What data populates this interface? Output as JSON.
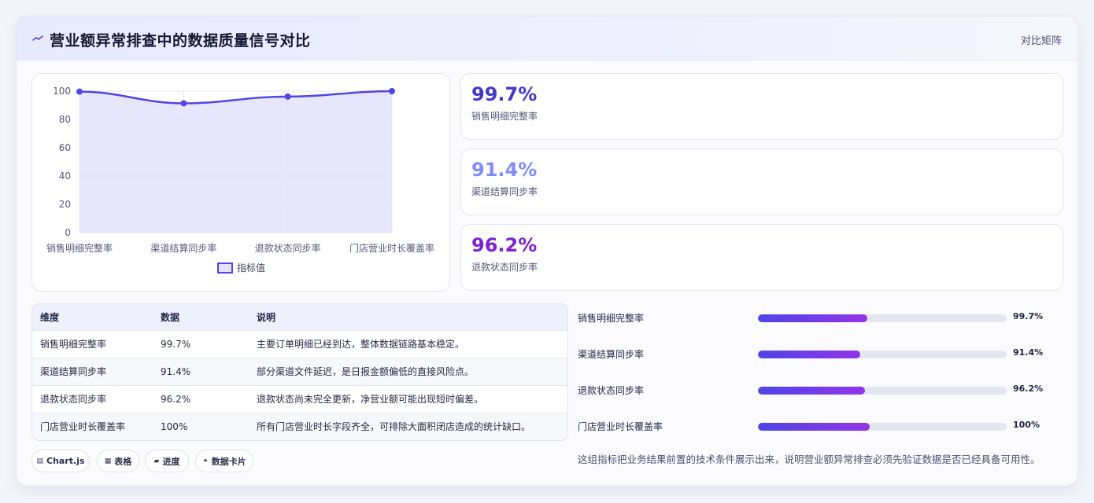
{
  "header": {
    "title": "营业额异常排查中的数据质量信号对比",
    "right_link": "对比矩阵"
  },
  "chart_data": {
    "type": "area",
    "categories": [
      "销售明细完整率",
      "渠道结算同步率",
      "退款状态同步率",
      "门店营业时长覆盖率"
    ],
    "series": [
      {
        "name": "指标值",
        "values": [
          99.7,
          91.4,
          96.2,
          100
        ]
      }
    ],
    "title": "",
    "xlabel": "",
    "ylabel": "",
    "ylim": [
      0,
      100
    ],
    "yticks": [
      "0",
      "20",
      "40",
      "60",
      "80",
      "100"
    ],
    "grid": true,
    "legend": "bottom",
    "colors": {
      "line": "#4f46e5",
      "fill": "#e4e2f9"
    }
  },
  "kpis": [
    {
      "value": "99.7%",
      "label": "销售明细完整率",
      "color": "#4338ca"
    },
    {
      "value": "91.4%",
      "label": "渠道结算同步率",
      "color": "#818cf8"
    },
    {
      "value": "96.2%",
      "label": "退款状态同步率",
      "color": "#7e22ce"
    }
  ],
  "table": {
    "headers": [
      "维度",
      "数据",
      "说明"
    ],
    "rows": [
      [
        "销售明细完整率",
        "99.7%",
        "主要订单明细已经到达，整体数据链路基本稳定。"
      ],
      [
        "渠道结算同步率",
        "91.4%",
        "部分渠道文件延迟，是日报金额偏低的直接风险点。"
      ],
      [
        "退款状态同步率",
        "96.2%",
        "退款状态尚未完全更新，净营业额可能出现短时偏差。"
      ],
      [
        "门店营业时长覆盖率",
        "100%",
        "所有门店营业时长字段齐全，可排除大面积闭店造成的统计缺口。"
      ]
    ]
  },
  "chips": [
    {
      "icon": "▤",
      "label": "Chart.js"
    },
    {
      "icon": "▦",
      "label": "表格"
    },
    {
      "icon": "▰",
      "label": "进度"
    },
    {
      "icon": "✦",
      "label": "数据卡片"
    }
  ],
  "progress": [
    {
      "label": "销售明细完整率",
      "value_text": "99.7%",
      "fill_fraction": 0.44
    },
    {
      "label": "渠道结算同步率",
      "value_text": "91.4%",
      "fill_fraction": 0.41
    },
    {
      "label": "退款状态同步率",
      "value_text": "96.2%",
      "fill_fraction": 0.43
    },
    {
      "label": "门店营业时长覆盖率",
      "value_text": "100%",
      "fill_fraction": 0.45
    }
  ],
  "footnote": "这组指标把业务结果前置的技术条件展示出来，说明营业额异常排查必须先验证数据是否已经具备可用性。"
}
